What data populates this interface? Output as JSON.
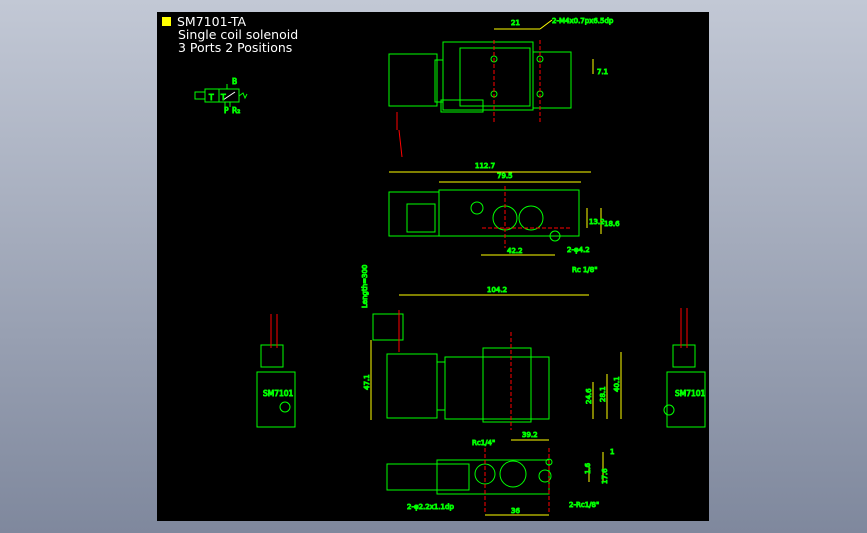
{
  "drawing": {
    "title": "SM7101-TA",
    "subtitle_line1": "Single coil solenoid",
    "subtitle_line2": "3 Ports 2 Positions",
    "accent_color": "#ffff00",
    "line_color": "#00ff00",
    "center_line_color": "#ff0000",
    "dim_color": "#ffff00"
  },
  "symbol": {
    "port_b": "B",
    "port_p": "P",
    "port_r": "R₂",
    "t1": "T",
    "t2": "T"
  },
  "dimensions": {
    "d21": "21",
    "screw": "2-M4x0.7px6.5dp",
    "d7_1": "7.1",
    "d112_7": "112.7",
    "d79_5": "79.5",
    "d13_2": "13.2",
    "d18_6": "18.6",
    "d42_2": "42.2",
    "hole42": "2-φ4.2",
    "rc18a": "Rc 1/8\"",
    "length300": "Length=300",
    "d104_2": "104.2",
    "d47_1": "47.1",
    "d24_6": "24.6",
    "d28_1": "28.1",
    "d40_1": "40.1",
    "d39_2": "39.2",
    "rc14": "Rc1/4\"",
    "d1": "1",
    "d1_6": "1.6",
    "d17_6": "17.6",
    "hole22": "2-φ2.2x1.1dp",
    "d36": "36",
    "rc18b": "2-Rc1/8\"",
    "label_side_left": "SM7101",
    "label_side_right": "SM7101"
  }
}
